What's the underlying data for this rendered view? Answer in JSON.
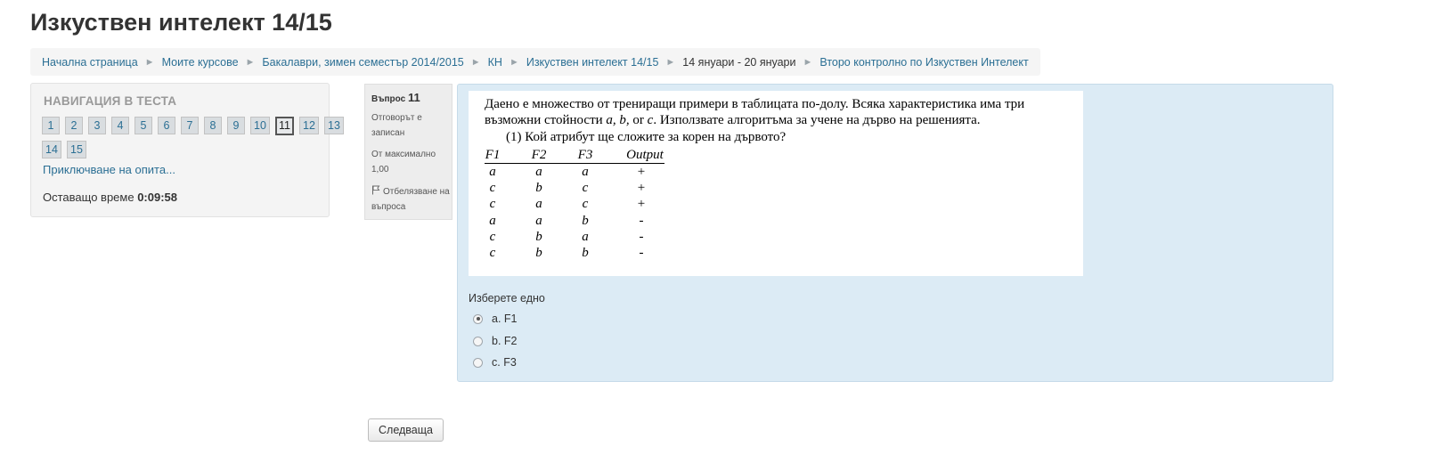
{
  "page": {
    "title": "Изкуствен интелект 14/15"
  },
  "breadcrumb": [
    {
      "label": "Начална страница",
      "link": true
    },
    {
      "label": "Моите курсове",
      "link": true
    },
    {
      "label": "Бакалаври, зимен семестър 2014/2015",
      "link": true
    },
    {
      "label": "КН",
      "link": true
    },
    {
      "label": "Изкуствен интелект 14/15",
      "link": true
    },
    {
      "label": "14 януари - 20 януари",
      "link": false
    },
    {
      "label": "Второ контролно по Изкуствен Интелект",
      "link": true
    }
  ],
  "quiz_nav": {
    "title": "НАВИГАЦИЯ В ТЕСТА",
    "questions": [
      "1",
      "2",
      "3",
      "4",
      "5",
      "6",
      "7",
      "8",
      "9",
      "10",
      "11",
      "12",
      "13",
      "14",
      "15"
    ],
    "current": "11",
    "finish_link": "Приключване на опита...",
    "time_label": "Оставащо време",
    "time_value": "0:09:58"
  },
  "question_info": {
    "label": "Въпрос",
    "number": "11",
    "state": "Отговорът е записан",
    "grade": "От максимално 1,00",
    "flag": "Отбелязване на въпроса"
  },
  "question": {
    "line1": "Даено е множество от трениращи примери в таблицата по-долу. Всяка характеристика има три",
    "line2_pre": "възможни стойности ",
    "line2_vars": "a, b,",
    "line2_or": " or ",
    "line2_c": "c",
    "line2_post": ". Използвате алгоритъма за учене на дърво на решенията.",
    "line3": "(1) Кой атрибут ще сложите за корен на дървото?",
    "table": {
      "headers": [
        "F1",
        "F2",
        "F3",
        "Output"
      ],
      "rows": [
        [
          "a",
          "a",
          "a",
          "+"
        ],
        [
          "c",
          "b",
          "c",
          "+"
        ],
        [
          "c",
          "a",
          "c",
          "+"
        ],
        [
          "a",
          "a",
          "b",
          "-"
        ],
        [
          "c",
          "b",
          "a",
          "-"
        ],
        [
          "c",
          "b",
          "b",
          "-"
        ]
      ]
    },
    "prompt": "Изберете едно",
    "answers": [
      {
        "label": "a. F1",
        "checked": true
      },
      {
        "label": "b. F2",
        "checked": false
      },
      {
        "label": "c. F3",
        "checked": false
      }
    ]
  },
  "buttons": {
    "next": "Следваща"
  },
  "colors": {
    "link": "#2b6f94",
    "question_bg": "#dcebf5"
  }
}
